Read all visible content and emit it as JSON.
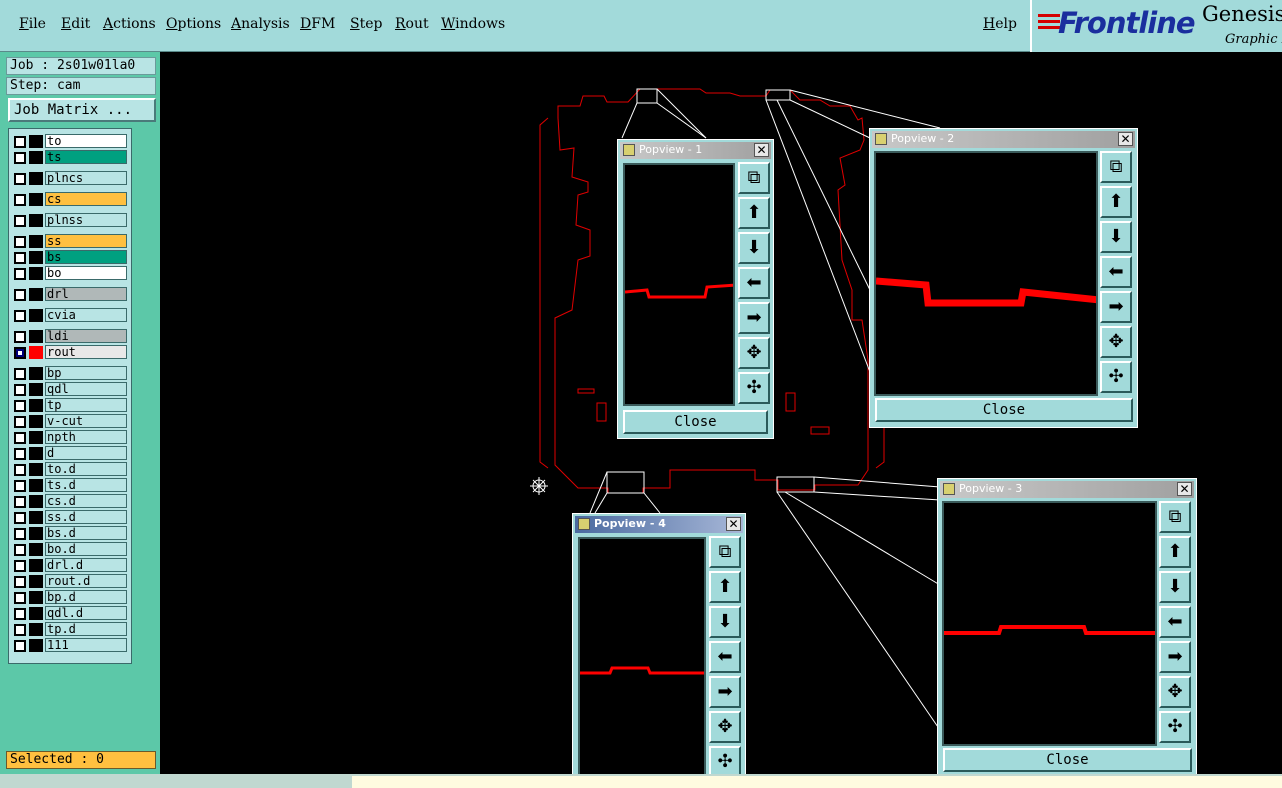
{
  "menu": {
    "file": "File",
    "edit": "Edit",
    "actions": "Actions",
    "options": "Options",
    "analysis": "Analysis",
    "dfm": "DFM",
    "step": "Step",
    "rout": "Rout",
    "windows": "Windows",
    "help": "Help"
  },
  "brand": {
    "logo": "Frontline",
    "product": "Genesis",
    "subtitle": "Graphic E"
  },
  "info": {
    "job": "Job : 2s01w01la0",
    "step": "Step: cam",
    "job_matrix": "Job Matrix ..."
  },
  "layers": [
    {
      "name": "to",
      "color": "#ffffff"
    },
    {
      "name": "ts",
      "color": "#00a080"
    },
    {
      "name": "plncs",
      "color": "#b8e4e4"
    },
    {
      "name": "cs",
      "color": "#ffc040"
    },
    {
      "name": "plnss",
      "color": "#b8e4e4"
    },
    {
      "name": "ss",
      "color": "#ffc040"
    },
    {
      "name": "bs",
      "color": "#00a080"
    },
    {
      "name": "bo",
      "color": "#ffffff"
    },
    {
      "name": "drl",
      "color": "#b0b8b8"
    },
    {
      "name": "cvia",
      "color": "#b8e4e4"
    },
    {
      "name": "ldi",
      "color": "#b0b8b8"
    },
    {
      "name": "rout",
      "color": "#e8e8e8"
    },
    {
      "name": "bp",
      "color": "#b8e4e4"
    },
    {
      "name": "qdl",
      "color": "#b8e4e4"
    },
    {
      "name": "tp",
      "color": "#b8e4e4"
    },
    {
      "name": "v-cut",
      "color": "#b8e4e4"
    },
    {
      "name": "npth",
      "color": "#b8e4e4"
    },
    {
      "name": "d",
      "color": "#b8e4e4"
    },
    {
      "name": "to.d",
      "color": "#b8e4e4"
    },
    {
      "name": "ts.d",
      "color": "#b8e4e4"
    },
    {
      "name": "cs.d",
      "color": "#b8e4e4"
    },
    {
      "name": "ss.d",
      "color": "#b8e4e4"
    },
    {
      "name": "bs.d",
      "color": "#b8e4e4"
    },
    {
      "name": "bo.d",
      "color": "#b8e4e4"
    },
    {
      "name": "drl.d",
      "color": "#b8e4e4"
    },
    {
      "name": "rout.d",
      "color": "#b8e4e4"
    },
    {
      "name": "bp.d",
      "color": "#b8e4e4"
    },
    {
      "name": "qdl.d",
      "color": "#b8e4e4"
    },
    {
      "name": "tp.d",
      "color": "#b8e4e4"
    },
    {
      "name": "111",
      "color": "#b8e4e4"
    }
  ],
  "selected": "Selected : 0",
  "popups": {
    "p1": {
      "title": "Popview - 1",
      "close": "Close"
    },
    "p2": {
      "title": "Popview - 2",
      "close": "Close"
    },
    "p3": {
      "title": "Popview - 3",
      "close": "Close"
    },
    "p4": {
      "title": "Popview - 4"
    }
  },
  "colors": {
    "panel": "#5cc8a8",
    "menubar": "#a2dada",
    "trace": "#ff0000",
    "outline": "#e00000"
  }
}
